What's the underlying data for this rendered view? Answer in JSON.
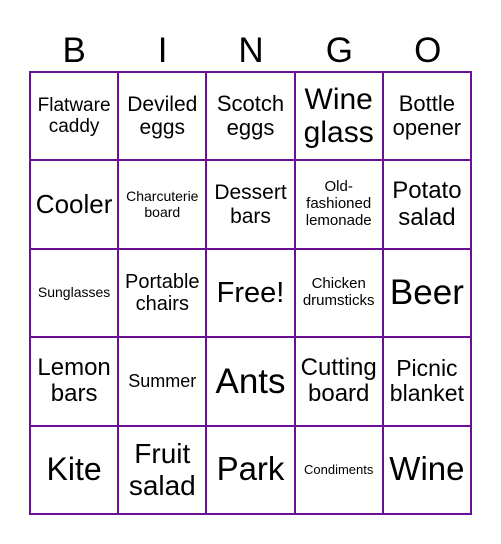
{
  "header": {
    "letters": [
      "B",
      "I",
      "N",
      "G",
      "O"
    ]
  },
  "board": {
    "grid_color": "#6b0f94",
    "cells": [
      {
        "text": "Flatware caddy",
        "size": "s19"
      },
      {
        "text": "Deviled eggs",
        "size": "s21"
      },
      {
        "text": "Scotch eggs",
        "size": "s22"
      },
      {
        "text": "Wine glass",
        "size": "s30"
      },
      {
        "text": "Bottle opener",
        "size": "s22"
      },
      {
        "text": "Cooler",
        "size": "s26"
      },
      {
        "text": "Charcuterie board",
        "size": "s14"
      },
      {
        "text": "Dessert bars",
        "size": "s21"
      },
      {
        "text": "Old-fashioned lemonade",
        "size": "s15"
      },
      {
        "text": "Potato salad",
        "size": "s24"
      },
      {
        "text": "Sunglasses",
        "size": "s14"
      },
      {
        "text": "Portable chairs",
        "size": "s20"
      },
      {
        "text": "Free!",
        "size": "s29"
      },
      {
        "text": "Chicken drumsticks",
        "size": "s15"
      },
      {
        "text": "Beer",
        "size": "s35"
      },
      {
        "text": "Lemon bars",
        "size": "s24"
      },
      {
        "text": "Summer",
        "size": "s18"
      },
      {
        "text": "Ants",
        "size": "s35"
      },
      {
        "text": "Cutting board",
        "size": "s24"
      },
      {
        "text": "Picnic blanket",
        "size": "s23"
      },
      {
        "text": "Kite",
        "size": "s32"
      },
      {
        "text": "Fruit salad",
        "size": "s28"
      },
      {
        "text": "Park",
        "size": "s33"
      },
      {
        "text": "Condiments",
        "size": "s13"
      },
      {
        "text": "Wine",
        "size": "s33"
      }
    ]
  }
}
